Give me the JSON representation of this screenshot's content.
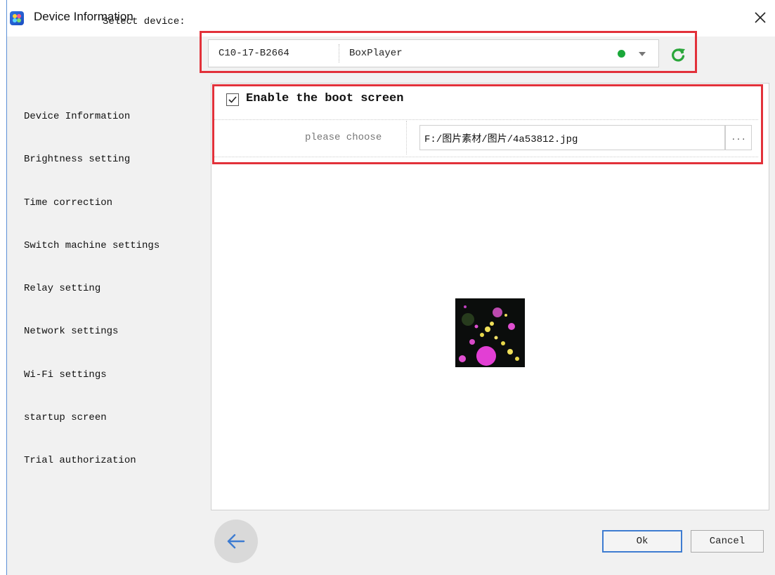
{
  "window": {
    "title": "Device Information"
  },
  "device_selector": {
    "label": "Select device:",
    "device_id": "C10-17-B2664",
    "device_name": "BoxPlayer",
    "status_color": "#1aa83a"
  },
  "sidebar": {
    "items": [
      {
        "label": "Device Information"
      },
      {
        "label": "Brightness setting"
      },
      {
        "label": "Time correction"
      },
      {
        "label": "Switch machine settings"
      },
      {
        "label": "Relay setting"
      },
      {
        "label": "Network settings"
      },
      {
        "label": "Wi-Fi settings"
      },
      {
        "label": "startup screen"
      },
      {
        "label": "Trial authorization"
      }
    ]
  },
  "boot_screen": {
    "checkbox_label": "Enable the boot screen",
    "checked": true,
    "choose_label": "please choose",
    "file_path": "F:/图片素材/图片/4a53812.jpg",
    "browse_label": "..."
  },
  "footer": {
    "ok_label": "Ok",
    "cancel_label": "Cancel"
  },
  "colors": {
    "highlight_box": "#e2313a",
    "accent": "#3e7cd1",
    "refresh_icon": "#2aa63a"
  }
}
